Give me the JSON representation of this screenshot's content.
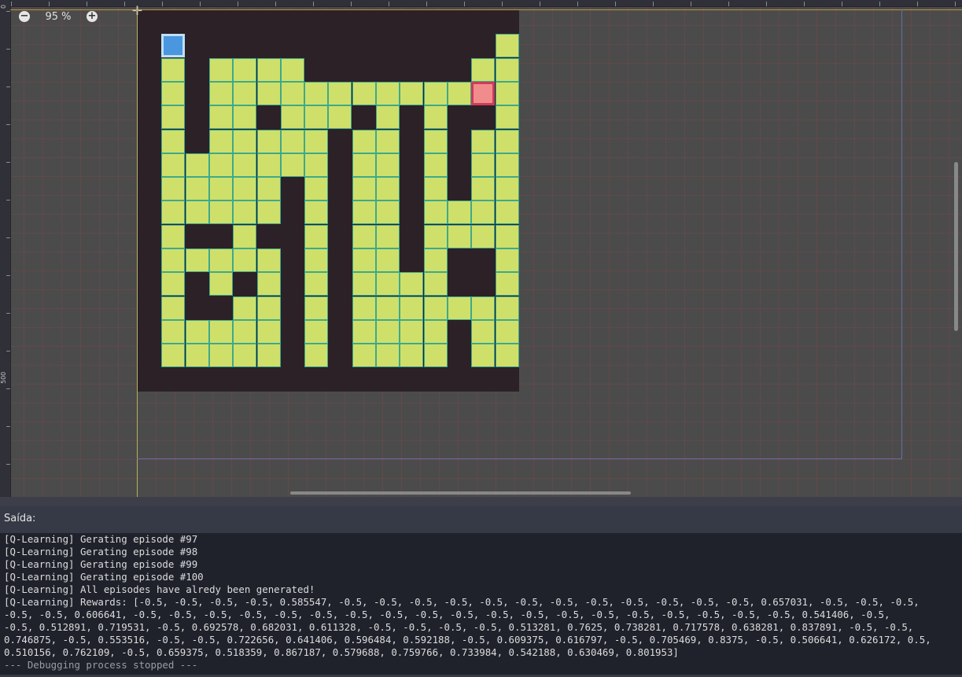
{
  "editor": {
    "zoom_label": "95 %",
    "zoom_out_icon": "minus-circle-icon",
    "zoom_in_icon": "plus-circle-icon",
    "ruler_labels": [
      "0",
      "500"
    ]
  },
  "maze": {
    "rows": 16,
    "cols": 16,
    "grid": [
      "################",
      "#A#############.",
      "#.#....#######..",
      "#.#...........G.",
      "#.#..#...#.#.##.",
      "#.#.....#..#.#..",
      "#.......#..#.#..",
      "#.....#.#..#.#..",
      "#.....#.#..#....",
      "#.##.##.#..#....",
      "#.....#.#..#.##.",
      "#.#.#.#.#....##.",
      "#.##..#.#.......",
      "#.....#.#....#..",
      "#.....#.#....#..",
      "################"
    ],
    "colors": {
      "wall": "#2b2127",
      "floor": "#cfe06a",
      "grid_line": "#3ea98a",
      "agent": "#4a97e0",
      "goal": "#f08c8c"
    }
  },
  "output": {
    "title": "Saída:",
    "lines": [
      "[Q-Learning] Gerating episode #97",
      "[Q-Learning] Gerating episode #98",
      "[Q-Learning] Gerating episode #99",
      "[Q-Learning] Gerating episode #100",
      "[Q-Learning] All episodes have alredy been generated!",
      "[Q-Learning] Rewards: [-0.5, -0.5, -0.5, -0.5, 0.585547, -0.5, -0.5, -0.5, -0.5, -0.5, -0.5, -0.5, -0.5, -0.5, -0.5, -0.5, -0.5, 0.657031, -0.5, -0.5, -0.5,",
      "-0.5, -0.5, 0.606641, -0.5, -0.5, -0.5, -0.5, -0.5, -0.5, -0.5, -0.5, -0.5, -0.5, -0.5, -0.5, -0.5, -0.5, -0.5, -0.5, -0.5, -0.5, -0.5, 0.541406, -0.5,",
      "-0.5, 0.512891, 0.719531, -0.5, 0.692578, 0.682031, 0.611328, -0.5, -0.5, -0.5, -0.5, 0.513281, 0.7625, 0.738281, 0.717578, 0.638281, 0.837891, -0.5, -0.5,",
      "0.746875, -0.5, 0.553516, -0.5, -0.5, 0.722656, 0.641406, 0.596484, 0.592188, -0.5, 0.609375, 0.616797, -0.5, 0.705469, 0.8375, -0.5, 0.506641, 0.626172, 0.5,",
      "0.510156, 0.762109, -0.5, 0.659375, 0.518359, 0.867187, 0.579688, 0.759766, 0.733984, 0.542188, 0.630469, 0.801953]",
      "--- Debugging process stopped ---"
    ]
  }
}
